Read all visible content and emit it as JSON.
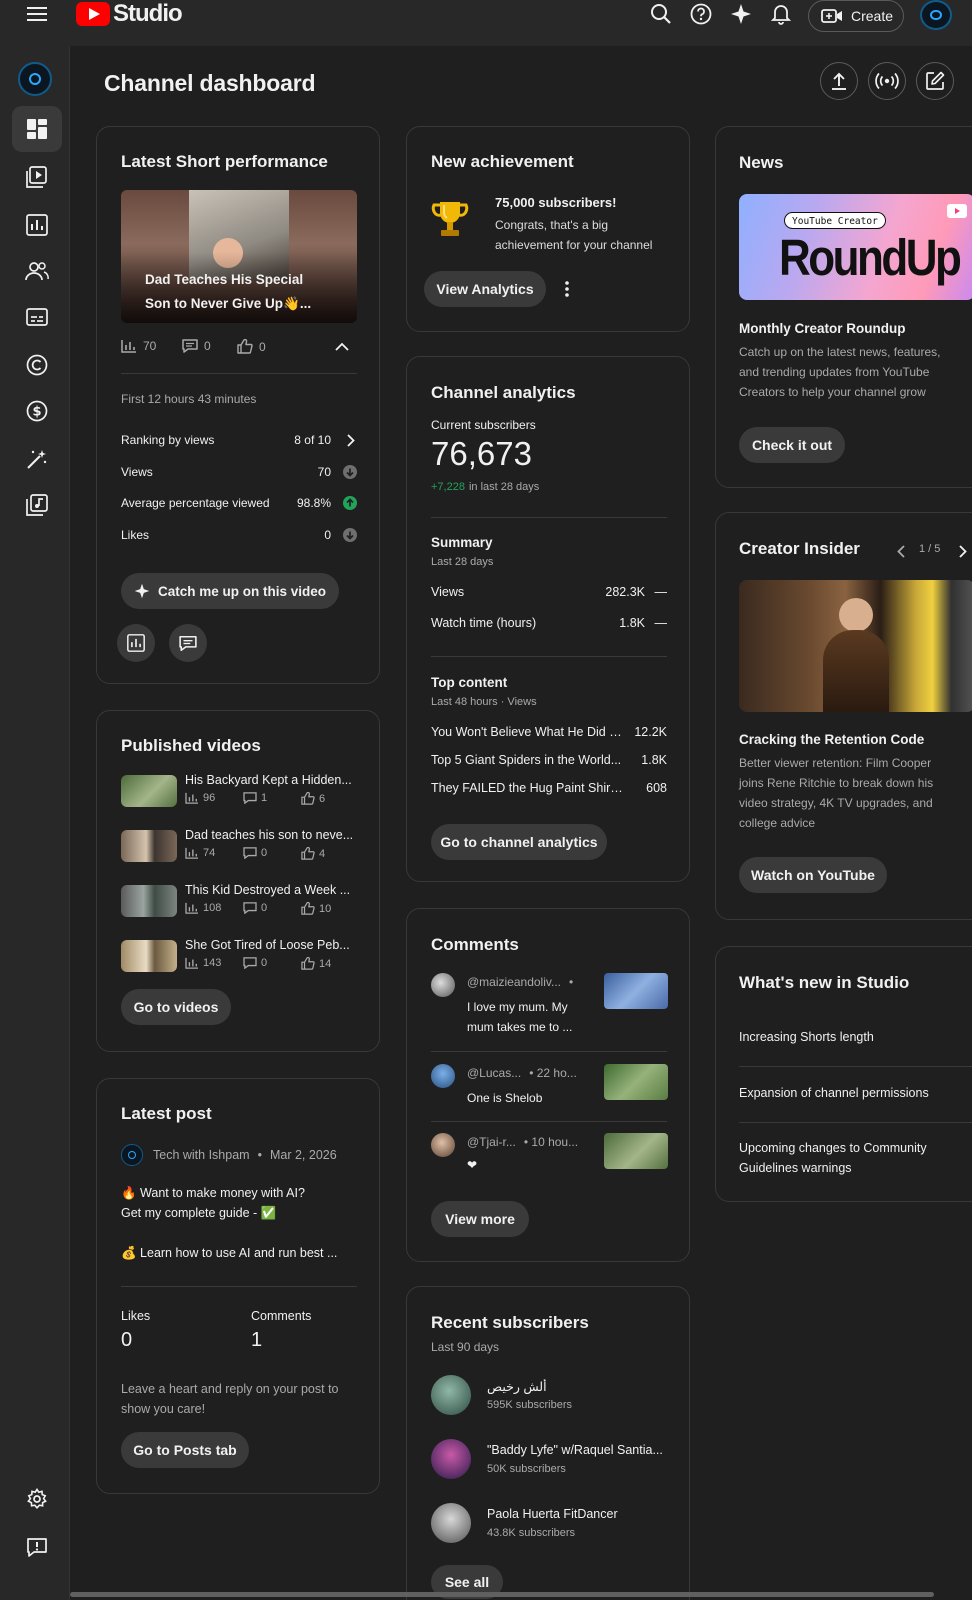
{
  "app": {
    "name": "Studio"
  },
  "topbar": {
    "create_label": "Create"
  },
  "page": {
    "title": "Channel dashboard"
  },
  "short_perf": {
    "title": "Latest Short performance",
    "video_title_line1": "Dad Teaches His Special",
    "video_title_line2": "Son to Never Give Up👋...",
    "views_count": "70",
    "comments_count": "0",
    "likes_count": "0",
    "period": "First 12 hours 43 minutes",
    "rows": [
      {
        "label": "Ranking by views",
        "value": "8 of 10"
      },
      {
        "label": "Views",
        "value": "70"
      },
      {
        "label": "Average percentage viewed",
        "value": "98.8%"
      },
      {
        "label": "Likes",
        "value": "0"
      }
    ],
    "catch_me_label": "Catch me up on this video"
  },
  "published": {
    "title": "Published videos",
    "items": [
      {
        "title": "His Backyard Kept a Hidden...",
        "views": "96",
        "comments": "1",
        "likes": "6"
      },
      {
        "title": "Dad teaches his son to neve...",
        "views": "74",
        "comments": "0",
        "likes": "4"
      },
      {
        "title": "This Kid Destroyed a Week ...",
        "views": "108",
        "comments": "0",
        "likes": "10"
      },
      {
        "title": "She Got Tired of Loose Peb...",
        "views": "143",
        "comments": "0",
        "likes": "14"
      }
    ],
    "button_label": "Go to videos"
  },
  "latest_post": {
    "title": "Latest post",
    "author": "Tech with Ishpam",
    "separator": "•",
    "date": "Mar 2, 2026",
    "line1": "🔥 Want to make money with AI?",
    "line2": "Get my complete guide - ✅",
    "line3": "💰 Learn how to use AI and run best ...",
    "likes_label": "Likes",
    "likes_value": "0",
    "comments_label": "Comments",
    "comments_value": "1",
    "hint_line1": "Leave a heart and reply on your post to",
    "hint_line2": "show you care!",
    "button_label": "Go to Posts tab"
  },
  "achievement": {
    "title": "New achievement",
    "headline": "75,000 subscribers!",
    "body_line1": "Congrats, that's a big",
    "body_line2": "achievement for your channel",
    "button_label": "View Analytics"
  },
  "analytics": {
    "title": "Channel analytics",
    "subs_label": "Current subscribers",
    "subs_value": "76,673",
    "subs_delta": "+7,228",
    "subs_delta_suffix": "in last 28 days",
    "summary_title": "Summary",
    "summary_period": "Last 28 days",
    "summary_rows": [
      {
        "label": "Views",
        "value": "282.3K",
        "trend": "—"
      },
      {
        "label": "Watch time (hours)",
        "value": "1.8K",
        "trend": "—"
      }
    ],
    "top_title": "Top content",
    "top_period": "Last 48 hours · Views",
    "top_rows": [
      {
        "label": "You Won't Believe What He Did t...",
        "value": "12.2K"
      },
      {
        "label": "Top 5 Giant Spiders in the World...",
        "value": "1.8K"
      },
      {
        "label": "They FAILED the Hug Paint Shirt...",
        "value": "608"
      }
    ],
    "button_label": "Go to channel analytics"
  },
  "comments": {
    "title": "Comments",
    "items": [
      {
        "author": "@maizieandoliv...",
        "time": "•",
        "line1": "I love my mum. My",
        "line2": "mum takes me to ..."
      },
      {
        "author": "@Lucas...",
        "time": "• 22 ho...",
        "line1": "One is Shelob",
        "line2": ""
      },
      {
        "author": "@Tjai-r...",
        "time": "• 10 hou...",
        "line1": "❤",
        "line2": ""
      }
    ],
    "button_label": "View more"
  },
  "recent_subs": {
    "title": "Recent subscribers",
    "period": "Last 90 days",
    "items": [
      {
        "name": "ألش رخيص",
        "count": "595K subscribers"
      },
      {
        "name": "\"Baddy Lyfe\" w/Raquel Santia...",
        "count": "50K subscribers"
      },
      {
        "name": "Paola Huerta FitDancer",
        "count": "43.8K subscribers"
      }
    ],
    "button_label": "See all"
  },
  "news": {
    "title": "News",
    "banner_tag": "YouTube Creator",
    "banner_title": "RoundUp",
    "headline": "Monthly Creator Roundup",
    "body_line1": "Catch up on the latest news, features,",
    "body_line2": "and trending updates from YouTube",
    "body_line3": "Creators to help your channel grow",
    "button_label": "Check it out"
  },
  "insider": {
    "title": "Creator Insider",
    "pager": "1 / 5",
    "headline": "Cracking the Retention Code",
    "body_line1": "Better viewer retention: Film Cooper",
    "body_line2": "joins Rene Ritchie to break down his",
    "body_line3": "video strategy, 4K TV upgrades, and",
    "body_line4": "college advice",
    "button_label": "Watch on YouTube"
  },
  "whats_new": {
    "title": "What's new in Studio",
    "items": [
      {
        "line1": "Increasing Shorts length",
        "line2": ""
      },
      {
        "line1": "Expansion of channel permissions",
        "line2": ""
      },
      {
        "line1": "Upcoming changes to Community",
        "line2": "Guidelines warnings"
      }
    ]
  },
  "colors": {
    "accent_red": "#ff0000",
    "positive_green": "#22a35a",
    "bg": "#1f1f1f"
  }
}
